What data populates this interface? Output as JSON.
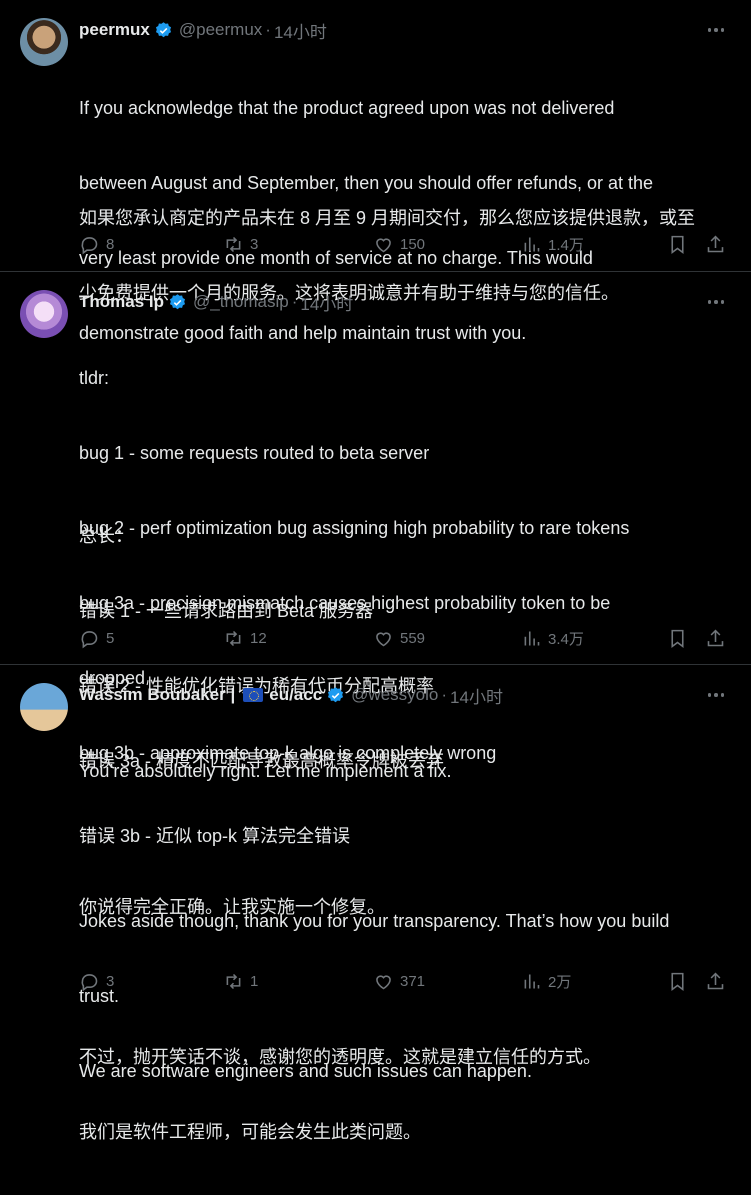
{
  "tweets": [
    {
      "name": "peermux",
      "handle": "@peermux",
      "time": "14小时",
      "body": [
        "If you acknowledge that the product agreed upon was not delivered",
        "between August and September, then you should offer refunds, or at the",
        "very least provide one month of service at no charge. This would",
        "demonstrate good faith and help maintain trust with you."
      ],
      "translation": [
        "如果您承认商定的产品未在 8 月至 9 月期间交付，那么您应该提供退款，或至",
        "少免费提供一个月的服务。这将表明诚意并有助于维持与您的信任。"
      ],
      "replies": "8",
      "reposts": "3",
      "likes": "150",
      "views": "1.4万"
    },
    {
      "name": "Thomas Ip",
      "handle": "@_thomasip",
      "time": "14小时",
      "body": [
        "tldr:",
        "bug 1 - some requests routed to beta server",
        "bug 2 - perf optimization bug assigning high probability to rare tokens",
        "bug 3a - precision mismatch causes highest probability token to be",
        "dropped",
        "bug 3b - approximate top-k algo is completely wrong"
      ],
      "translation": [
        "总长：",
        "错误 1 - 一些请求路由到 Beta 服务器",
        "错误 2 - 性能优化错误为稀有代币分配高概率",
        "错误 3a - 精度不匹配导致最高概率令牌被丢弃",
        "错误 3b - 近似 top-k 算法完全错误"
      ],
      "replies": "5",
      "reposts": "12",
      "likes": "559",
      "views": "3.4万"
    },
    {
      "name": "Wassim Boubaker |",
      "name_suffix": "eu/acc",
      "handle": "@wessyolo",
      "time": "14小时",
      "body": [
        "You’re absolutely right. Let me implement a fix.",
        "",
        "Jokes aside though, thank you for your transparency. That’s how you build",
        "trust.",
        "We are software engineers and such issues can happen."
      ],
      "translation": [
        "你说得完全正确。让我实施一个修复。",
        "",
        "不过，抛开笑话不谈，感谢您的透明度。这就是建立信任的方式。",
        "我们是软件工程师，可能会发生此类问题。"
      ],
      "replies": "3",
      "reposts": "1",
      "likes": "371",
      "views": "2万"
    }
  ],
  "colors": {
    "background": "#000000",
    "text": "#e7e9ea",
    "muted": "#71767b",
    "verified": "#1d9bf0",
    "divider": "#2f3336"
  },
  "icons": [
    "reply-icon",
    "repost-icon",
    "like-icon",
    "views-icon",
    "bookmark-icon",
    "share-icon",
    "more-icon",
    "verified-badge-icon",
    "eu-flag-icon"
  ]
}
